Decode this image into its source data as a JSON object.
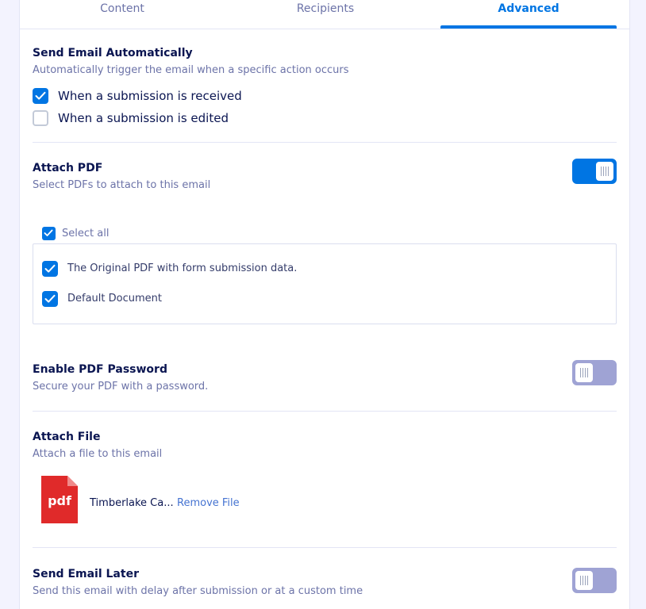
{
  "tabs": [
    {
      "label": "Content"
    },
    {
      "label": "Recipients"
    },
    {
      "label": "Advanced",
      "active": true
    }
  ],
  "send_auto": {
    "title": "Send Email Automatically",
    "description": "Automatically trigger the email when a specific action occurs",
    "options": [
      {
        "label": "When a submission is received",
        "checked": true
      },
      {
        "label": "When a submission is edited",
        "checked": false
      }
    ]
  },
  "attach_pdf": {
    "title": "Attach PDF",
    "description": "Select PDFs to attach to this email",
    "enabled": true,
    "select_all_label": "Select all",
    "documents": [
      {
        "label": "The Original PDF with form submission data.",
        "checked": true
      },
      {
        "label": "Default Document",
        "checked": true
      }
    ]
  },
  "pdf_password": {
    "title": "Enable PDF Password",
    "description": "Secure your PDF with a password.",
    "enabled": false
  },
  "attach_file": {
    "title": "Attach File",
    "description": "Attach a file to this email",
    "file_icon_text": "pdf",
    "file_name": "Timberlake Ca...",
    "remove_label": "Remove File"
  },
  "send_later": {
    "title": "Send Email Later",
    "description": "Send this email with delay after submission or at a custom time",
    "enabled": false
  },
  "colors": {
    "accent": "#0075e3",
    "toggle_off": "#9fa3d4",
    "pdf_red": "#e02a2a",
    "title_text": "#0a1551",
    "muted_text": "#6c73a8"
  }
}
